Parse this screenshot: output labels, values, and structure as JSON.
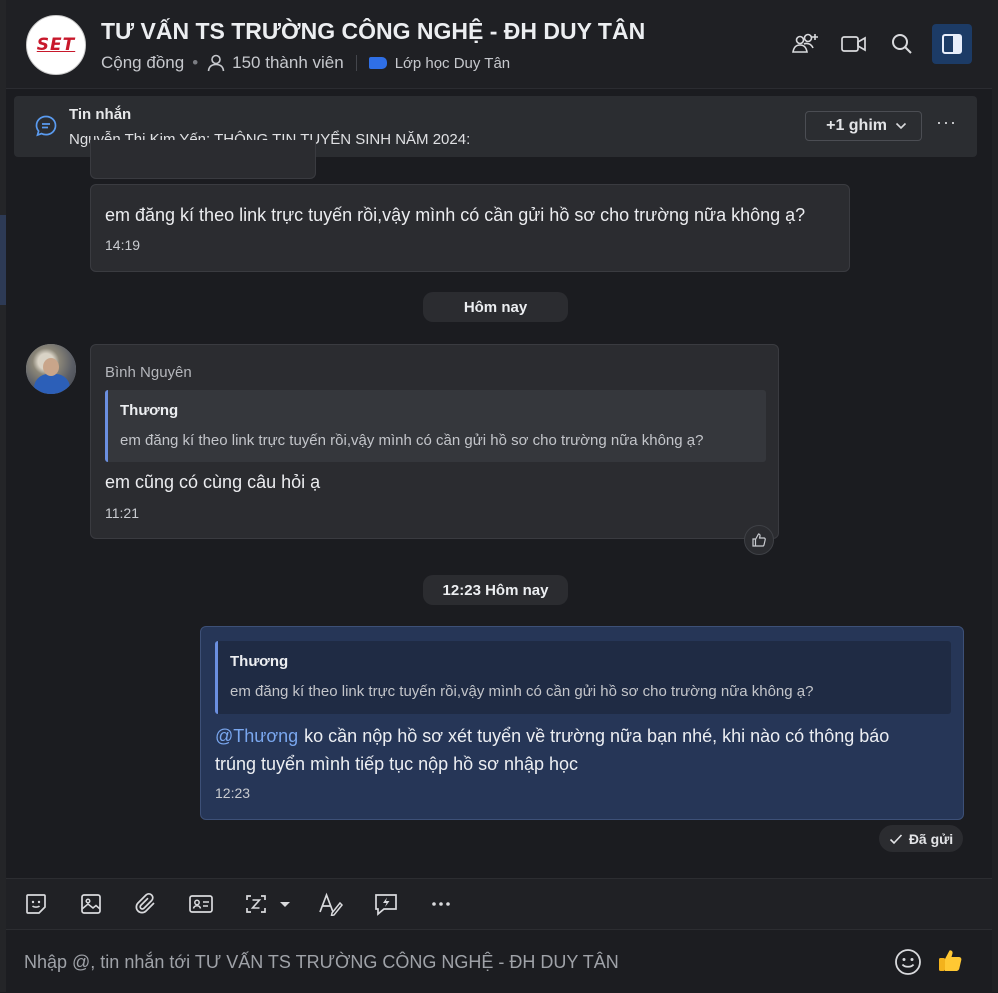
{
  "header": {
    "logo_text": "SET",
    "title": "TƯ VẤN TS TRƯỜNG CÔNG NGHỆ - ĐH DUY TÂN",
    "community": "Cộng đồng",
    "members": "150 thành viên",
    "class_tag": "Lớp học Duy Tân",
    "icons": [
      "add-group-icon",
      "video-call-icon",
      "search-icon",
      "sidebar-toggle-icon"
    ]
  },
  "pinned": {
    "title": "Tin nhắn",
    "text": "Nguyễn Thị Kim Yến: THÔNG TIN TUYỂN SINH NĂM 2024:",
    "pin_count": "+1 ghim",
    "more": "···"
  },
  "messages": {
    "m1": {
      "text": "em đăng kí theo link trực tuyến rồi,vậy mình có cần gửi hồ sơ cho trường nữa không ạ?",
      "time": "14:19"
    },
    "date1": "Hôm nay",
    "m2": {
      "sender": "Bình Nguyên",
      "quote_name": "Thương",
      "quote_text": "em đăng kí theo link trực tuyến rồi,vậy mình có cần gửi hồ sơ cho trường nữa không ạ?",
      "text": "em cũng có cùng câu hỏi ạ",
      "time": "11:21"
    },
    "date2": "12:23 Hôm nay",
    "m3": {
      "quote_name": "Thương",
      "quote_text": "em đăng kí theo link trực tuyến rồi,vậy mình có cần gửi hồ sơ cho trường nữa không ạ?",
      "mention": "@Thương",
      "text": "ko cần nộp hồ sơ xét tuyển về trường nữa bạn nhé, khi nào có thông báo trúng tuyển mình tiếp tục nộp hồ sơ nhập học",
      "time": "12:23",
      "status": "Đã gửi"
    }
  },
  "composer": {
    "placeholder": "Nhập @, tin nhắn tới TƯ VẤN TS TRƯỜNG CÔNG NGHỆ - ĐH DUY TÂN",
    "tools": [
      "sticker-icon",
      "image-icon",
      "attachment-icon",
      "contact-card-icon",
      "screenshot-icon",
      "format-text-icon",
      "quick-message-icon",
      "more-icon"
    ]
  },
  "colors": {
    "accent": "#2f6fe6",
    "own_bubble": "#263657",
    "mention": "#7aa7ef"
  }
}
